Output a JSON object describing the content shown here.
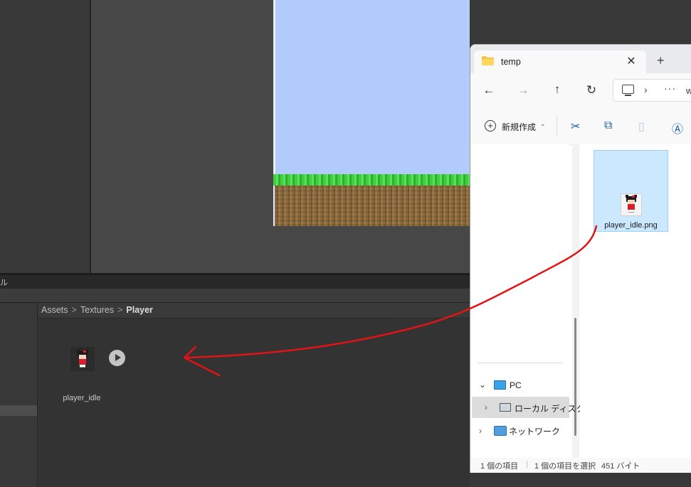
{
  "unity": {
    "panel_tab_label": "ル",
    "breadcrumb": {
      "root": "Assets",
      "folder": "Textures",
      "current": "Player"
    },
    "asset": {
      "name": "player_idle"
    }
  },
  "explorer": {
    "tab_title": "temp",
    "tab_close": "✕",
    "new_tab": "+",
    "nav": {
      "back": "←",
      "forward": "→",
      "up": "↑",
      "refresh": "↻"
    },
    "address": {
      "chevron": "›",
      "more": "···",
      "text": "w"
    },
    "command_bar": {
      "new_label": "新規作成",
      "new_caret": "⌄"
    },
    "file": {
      "name": "player_idle.png",
      "selected": true
    },
    "nav_pane": {
      "items": [
        {
          "label": "PC",
          "chevron": "⌄"
        },
        {
          "label": "ローカル ディスク",
          "chevron": "›"
        },
        {
          "label": "ネットワーク",
          "chevron": "›"
        }
      ]
    },
    "status": {
      "count": "1 個の項目",
      "separator": "|",
      "selected": "1 個の項目を選択",
      "size": "451 バイト"
    }
  },
  "colors": {
    "annotation_arrow": "#e11414",
    "selection": "#cce8ff",
    "sky": "#b3cbfb"
  }
}
